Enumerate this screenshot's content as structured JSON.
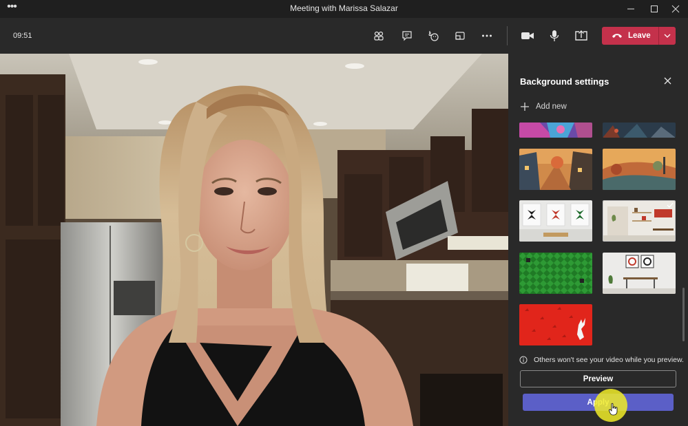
{
  "window": {
    "title": "Meeting with Marissa Salazar",
    "menu_glyph": "•••"
  },
  "toolbar": {
    "timer": "09:51",
    "leave_label": "Leave",
    "leave_color": "#c4314b",
    "icons": [
      "people-icon",
      "chat-icon",
      "react-icon",
      "rooms-icon",
      "more-icon",
      "camera-icon",
      "mic-icon",
      "share-icon"
    ]
  },
  "panel": {
    "title": "Background settings",
    "add_new_label": "Add new",
    "notice": "Others won't see your video while you preview.",
    "preview_label": "Preview",
    "apply_label": "Apply",
    "apply_color": "#5b5fc7",
    "backgrounds": [
      {
        "name": "colorful-abstract"
      },
      {
        "name": "fantasy-forest"
      },
      {
        "name": "autumn-village-street"
      },
      {
        "name": "autumn-landscape"
      },
      {
        "name": "leaf-prints-wall"
      },
      {
        "name": "modern-office-shelves",
        "selected": true
      },
      {
        "name": "green-pattern"
      },
      {
        "name": "framed-art-office"
      },
      {
        "name": "red-reindeer-pattern"
      }
    ]
  }
}
